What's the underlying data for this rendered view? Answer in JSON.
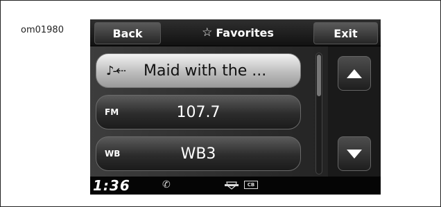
{
  "figure_id": "om01980",
  "topbar": {
    "back_label": "Back",
    "favorites_label": "Favorites",
    "favorites_icon": "star-outline-icon",
    "exit_label": "Exit"
  },
  "favorites": [
    {
      "type": "usb-media",
      "icon": "music-usb-icon",
      "icon_glyph": "♪-⇠",
      "text": "Maid with the ...",
      "selected": true
    },
    {
      "type": "radio",
      "band": "FM",
      "station": "107.7",
      "selected": false
    },
    {
      "type": "radio",
      "band": "WB",
      "station": "WB3",
      "selected": false
    }
  ],
  "scroll": {
    "up_icon": "arrow-up-icon",
    "down_icon": "arrow-down-icon"
  },
  "status": {
    "time": "1:36",
    "phone_icon": "phone-icon",
    "logo_icon": "bar-and-shield-logo-icon",
    "cb_label": "CB"
  },
  "colors": {
    "screen_bg": "#111111",
    "selected_item": "#d9d9d9",
    "text_light": "#ffffff"
  }
}
